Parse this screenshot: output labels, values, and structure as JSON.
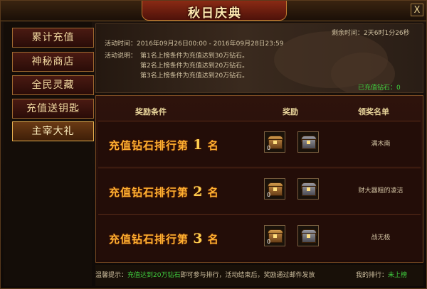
{
  "window": {
    "title": "秋日庆典",
    "close_label": "X"
  },
  "sidebar": {
    "items": [
      {
        "label": "累计充值",
        "active": false
      },
      {
        "label": "神秘商店",
        "active": false
      },
      {
        "label": "全民灵藏",
        "active": false
      },
      {
        "label": "充值送钥匙",
        "active": false
      },
      {
        "label": "主宰大礼",
        "active": true
      }
    ]
  },
  "info": {
    "countdown_label": "剩余时间：",
    "countdown_value": "2天6时1分26秒",
    "time_label": "活动时间：",
    "time_value": "2016年09月26日00:00 - 2016年09月28日23:59",
    "desc_label": "活动说明：",
    "desc_lines": [
      "第1名上榜条件为充值达到30万钻石。",
      "第2名上榜条件为充值达到20万钻石。",
      "第3名上榜条件为充值达到20万钻石。"
    ],
    "charged_label": "已充值钻石：",
    "charged_value": "0"
  },
  "table": {
    "headers": {
      "condition": "奖励条件",
      "reward": "奖励",
      "winners": "领奖名单"
    },
    "rows": [
      {
        "rank_text": "充值钻石排行第",
        "rank_num": "1",
        "rank_suffix": "名",
        "winner": "满木南",
        "chest1_count": "0",
        "chest2_count": "0"
      },
      {
        "rank_text": "充值钻石排行第",
        "rank_num": "2",
        "rank_suffix": "名",
        "winner": "财大器粗的凌洁",
        "chest1_count": "0",
        "chest2_count": "0"
      },
      {
        "rank_text": "充值钻石排行第",
        "rank_num": "3",
        "rank_suffix": "名",
        "winner": "战无极",
        "chest1_count": "0",
        "chest2_count": "0"
      }
    ]
  },
  "footer": {
    "tip_label": "温馨提示：",
    "tip_highlight": "充值达到20万钻石",
    "tip_rest": "即可参与排行，活动结束后，奖励通过邮件发放",
    "my_rank_label": "我的排行：",
    "my_rank_value": "未上榜"
  }
}
